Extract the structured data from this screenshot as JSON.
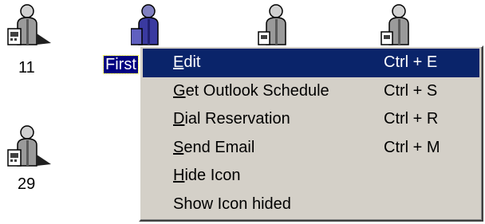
{
  "desktop": {
    "icons": [
      {
        "label": "11"
      },
      {
        "label": "First"
      },
      {
        "label": ""
      },
      {
        "label": ""
      },
      {
        "label": "29"
      }
    ]
  },
  "context_menu": {
    "items": [
      {
        "accel": "E",
        "rest": "dit",
        "shortcut": "Ctrl + E",
        "highlighted": true
      },
      {
        "accel": "G",
        "rest": "et Outlook Schedule",
        "shortcut": "Ctrl + S"
      },
      {
        "accel": "D",
        "rest": "ial Reservation",
        "shortcut": "Ctrl + R"
      },
      {
        "accel": "S",
        "rest": "end Email",
        "shortcut": "Ctrl + M"
      },
      {
        "accel": "H",
        "rest": "ide Icon",
        "shortcut": ""
      },
      {
        "accel": "",
        "rest": "Show Icon hided",
        "shortcut": ""
      }
    ]
  },
  "colors": {
    "menu_background": "#d4d0c8",
    "highlight": "#0a246a",
    "selected_label": "#000080",
    "person_grey": "#9a9a9a",
    "person_selected": "#3a3aa0",
    "phone_grey": "#6a6a6a"
  }
}
